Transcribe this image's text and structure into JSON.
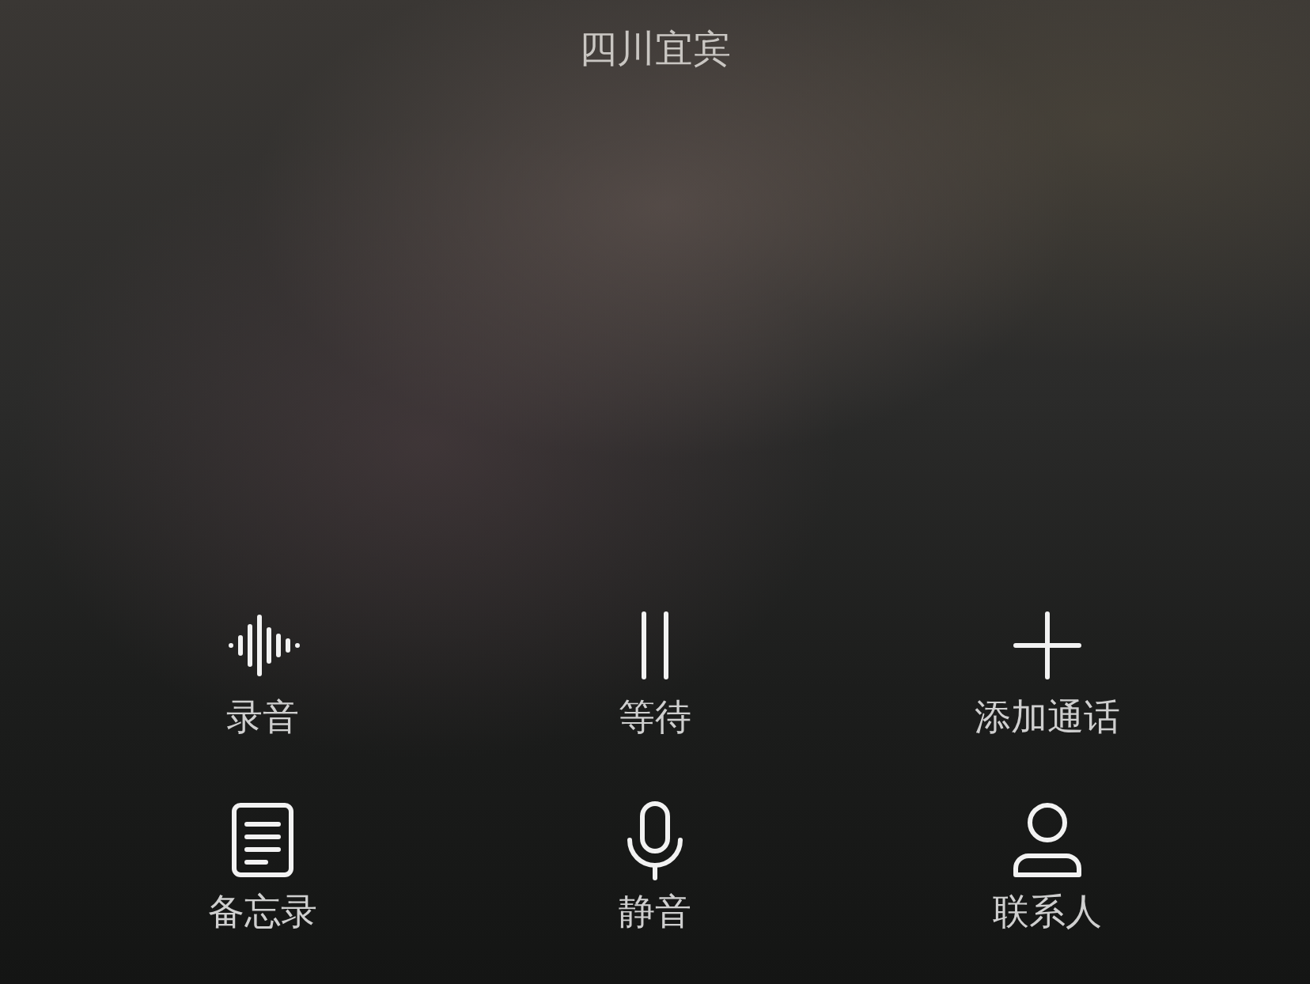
{
  "location": "四川宜宾",
  "buttons": [
    {
      "kind": "record",
      "label": "录音"
    },
    {
      "kind": "hold",
      "label": "等待"
    },
    {
      "kind": "add",
      "label": "添加通话"
    },
    {
      "kind": "notes",
      "label": "备忘录"
    },
    {
      "kind": "mute",
      "label": "静音"
    },
    {
      "kind": "contacts",
      "label": "联系人"
    }
  ]
}
